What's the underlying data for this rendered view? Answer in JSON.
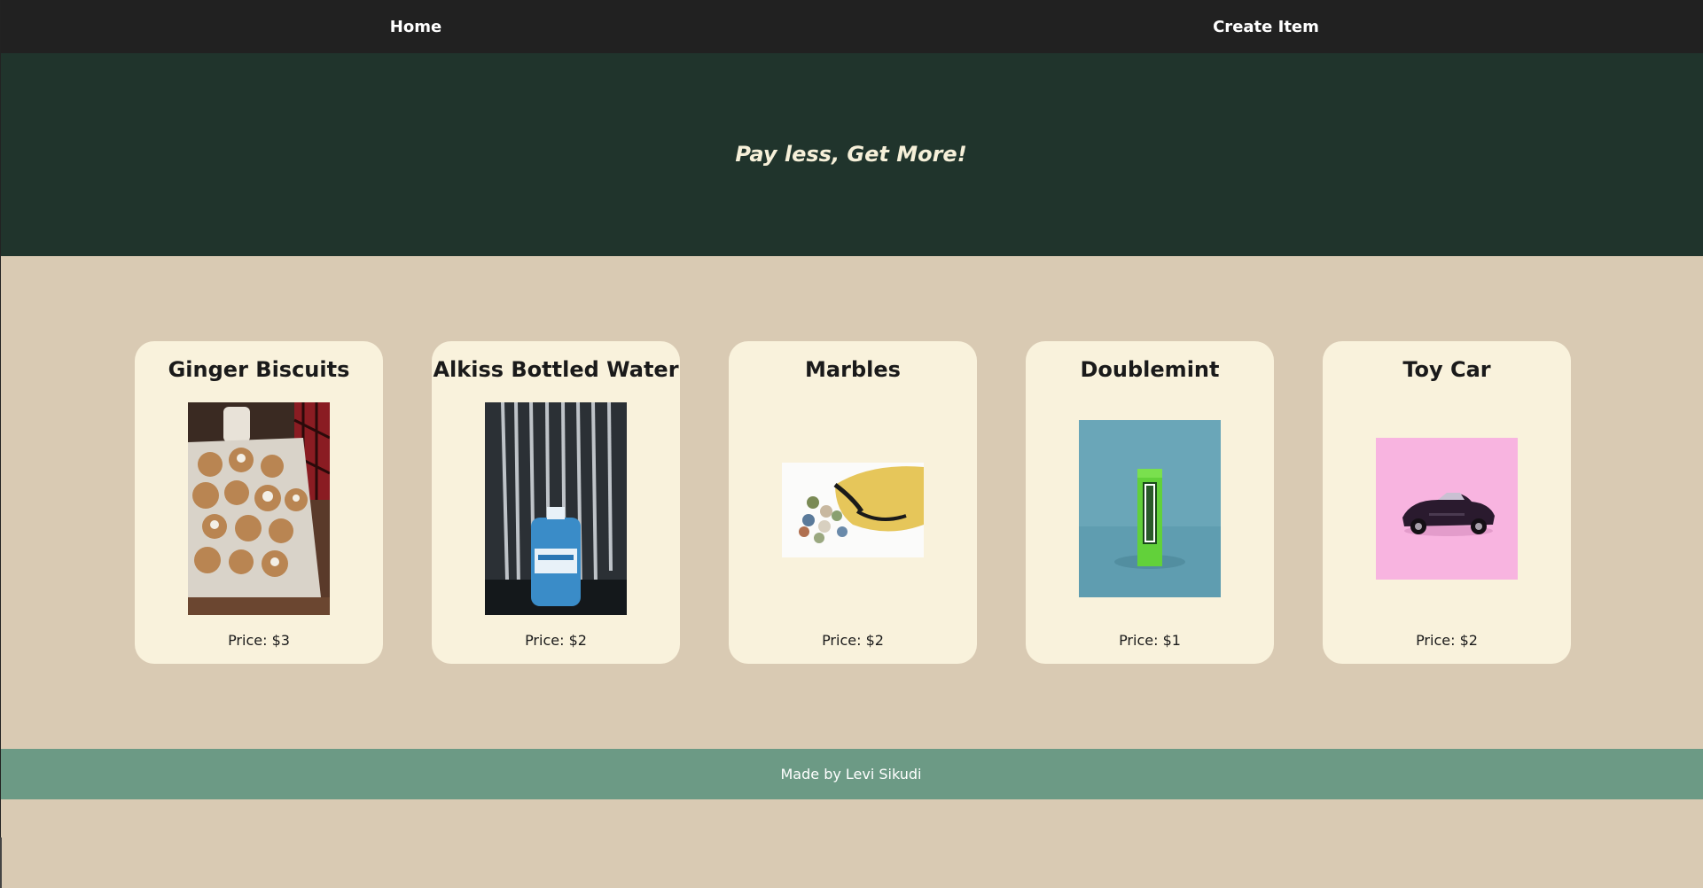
{
  "nav": {
    "home_label": "Home",
    "create_label": "Create Item"
  },
  "hero": {
    "tagline": "Pay less, Get More!"
  },
  "products": [
    {
      "title": "Ginger Biscuits",
      "price": "Price: $3",
      "image": "ginger-biscuits-photo"
    },
    {
      "title": "Alkiss Bottled Water",
      "price": "Price: $2",
      "image": "bottled-water-waterfall-photo"
    },
    {
      "title": "Marbles",
      "price": "Price: $2",
      "image": "marbles-bag-photo"
    },
    {
      "title": "Doublemint",
      "price": "Price: $1",
      "image": "doublemint-gum-photo"
    },
    {
      "title": "Toy Car",
      "price": "Price: $2",
      "image": "toy-car-photo"
    }
  ],
  "footer": {
    "credit": "Made by Levi Sikudi"
  },
  "colors": {
    "nav_bg": "#212121",
    "hero_bg": "#20342c",
    "page_bg": "#d9cab3",
    "card_bg": "#f9f2dc",
    "footer_bg": "#6c9a85"
  }
}
